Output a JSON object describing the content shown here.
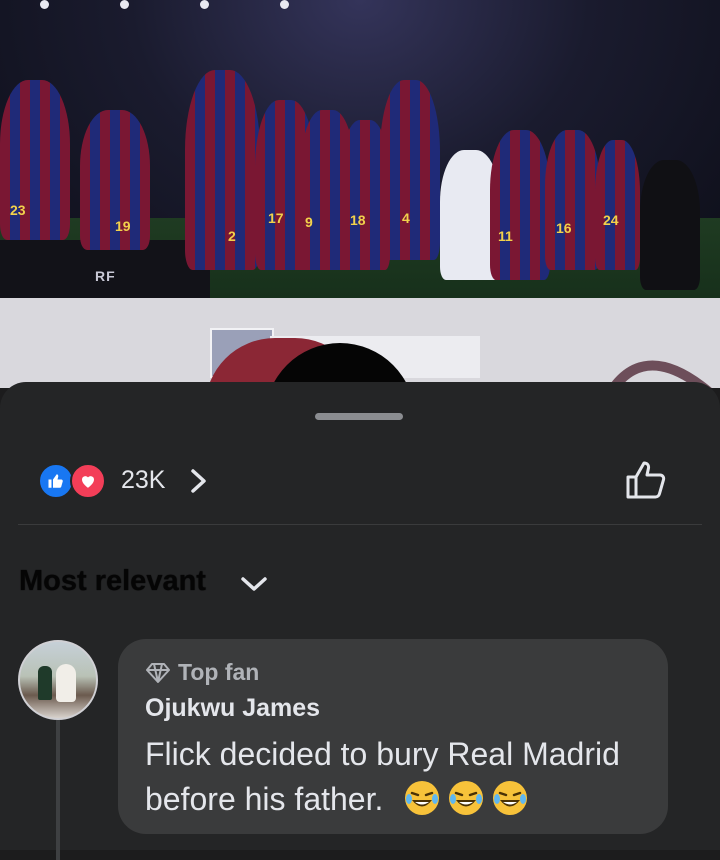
{
  "post": {
    "reaction_count": "23K",
    "reaction_types": [
      "like-icon",
      "love-icon"
    ]
  },
  "comments_sheet": {
    "sort_label": "Most relevant",
    "comments": [
      {
        "badge": "Top fan",
        "author": "Ojukwu James",
        "text": "Flick decided to bury Real Madrid before his father.",
        "emojis": [
          "laughing-crying-emoji",
          "laughing-crying-emoji",
          "laughing-crying-emoji"
        ]
      }
    ]
  },
  "photo": {
    "jersey_numbers": [
      "23",
      "19",
      "2",
      "17",
      "9",
      "18",
      "4",
      "11",
      "16",
      "24"
    ],
    "board_text": "RF"
  },
  "colors": {
    "sheet_bg": "#242526",
    "bubble_bg": "#3a3b3c",
    "like_blue": "#1877f2",
    "love_red": "#f33e58",
    "text_primary": "#e4e6eb",
    "text_secondary": "#b0b3b8"
  }
}
